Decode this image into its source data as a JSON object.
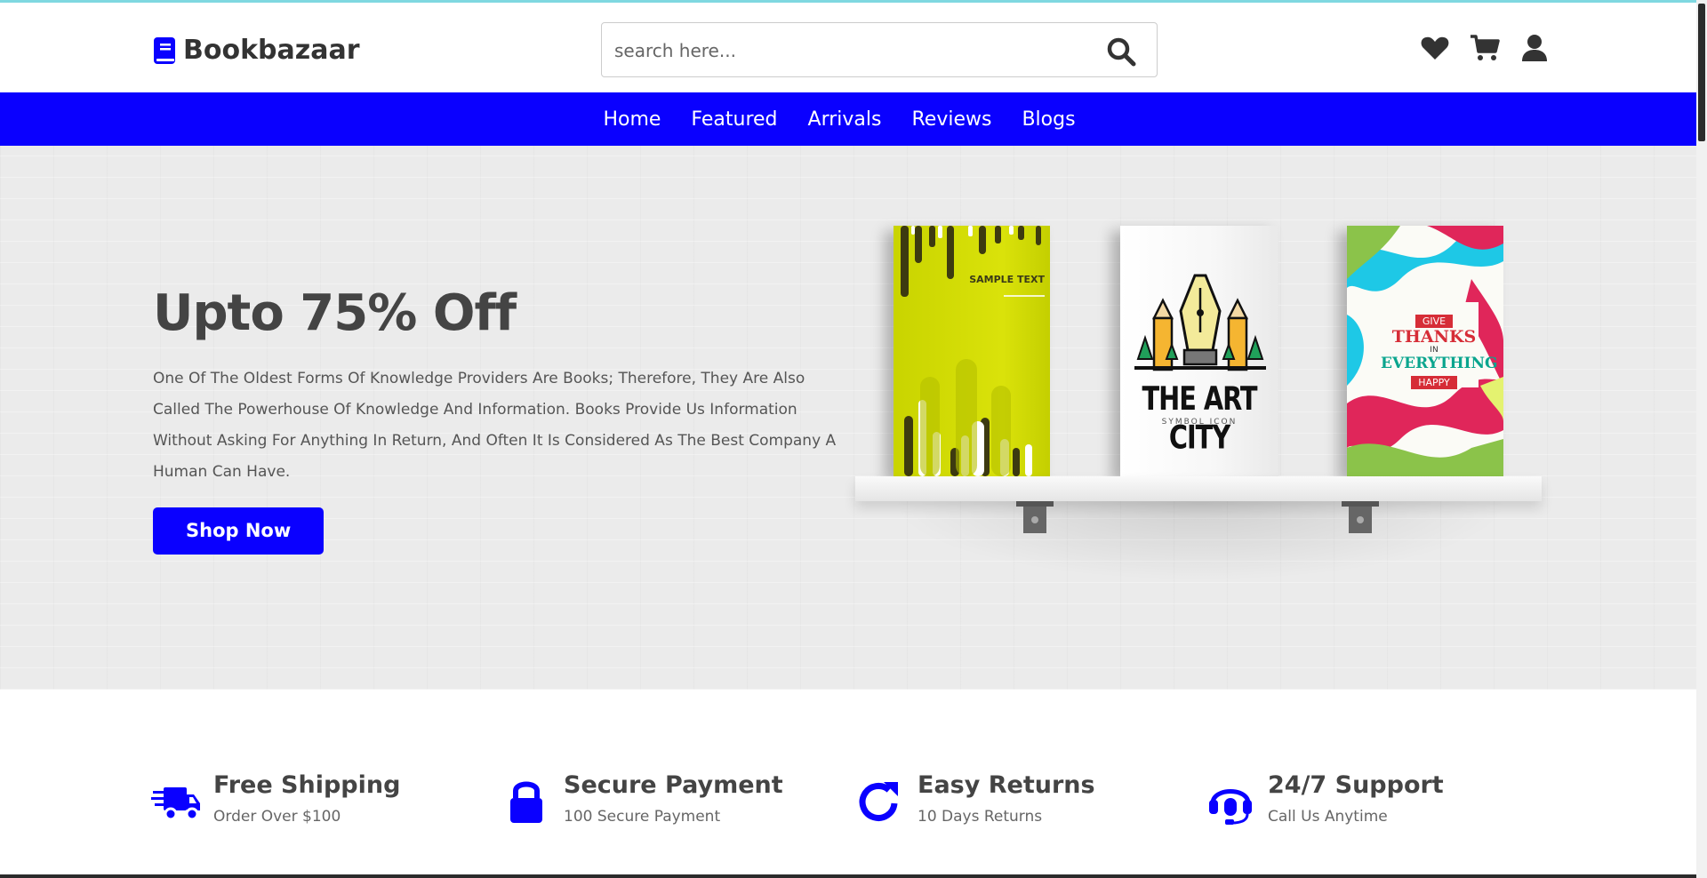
{
  "brand": {
    "name": "Bookbazaar"
  },
  "search": {
    "placeholder": "search here..."
  },
  "nav": {
    "items": [
      "Home",
      "Featured",
      "Arrivals",
      "Reviews",
      "Blogs"
    ]
  },
  "hero": {
    "title": "Upto 75% Off",
    "description": "One Of The Oldest Forms Of Knowledge Providers Are Books; Therefore, They Are Also Called The Powerhouse Of Knowledge And Information. Books Provide Us Information Without Asking For Anything In Return, And Often It Is Considered As The Best Company A Human Can Have.",
    "cta": "Shop Now",
    "books": [
      {
        "text": "SAMPLE TEXT"
      },
      {
        "title": "THE ART CITY",
        "subtitle": "SYMBOL ICON"
      },
      {
        "line1": "GIVE",
        "line2": "THANKS",
        "line3": "IN",
        "line4": "EVERYTHING",
        "line5": "HAPPY"
      }
    ]
  },
  "features": [
    {
      "title": "Free Shipping",
      "subtitle": "Order Over $100",
      "icon": "truck-icon"
    },
    {
      "title": "Secure Payment",
      "subtitle": "100 Secure Payment",
      "icon": "lock-icon"
    },
    {
      "title": "Easy Returns",
      "subtitle": "10 Days Returns",
      "icon": "redo-icon"
    },
    {
      "title": "24/7 Support",
      "subtitle": "Call Us Anytime",
      "icon": "headset-icon"
    }
  ],
  "colors": {
    "accent": "#0a00ff",
    "text": "#444444",
    "hero_bg": "#ebebeb"
  },
  "header_icons": [
    "heart-icon",
    "cart-icon",
    "user-icon"
  ]
}
